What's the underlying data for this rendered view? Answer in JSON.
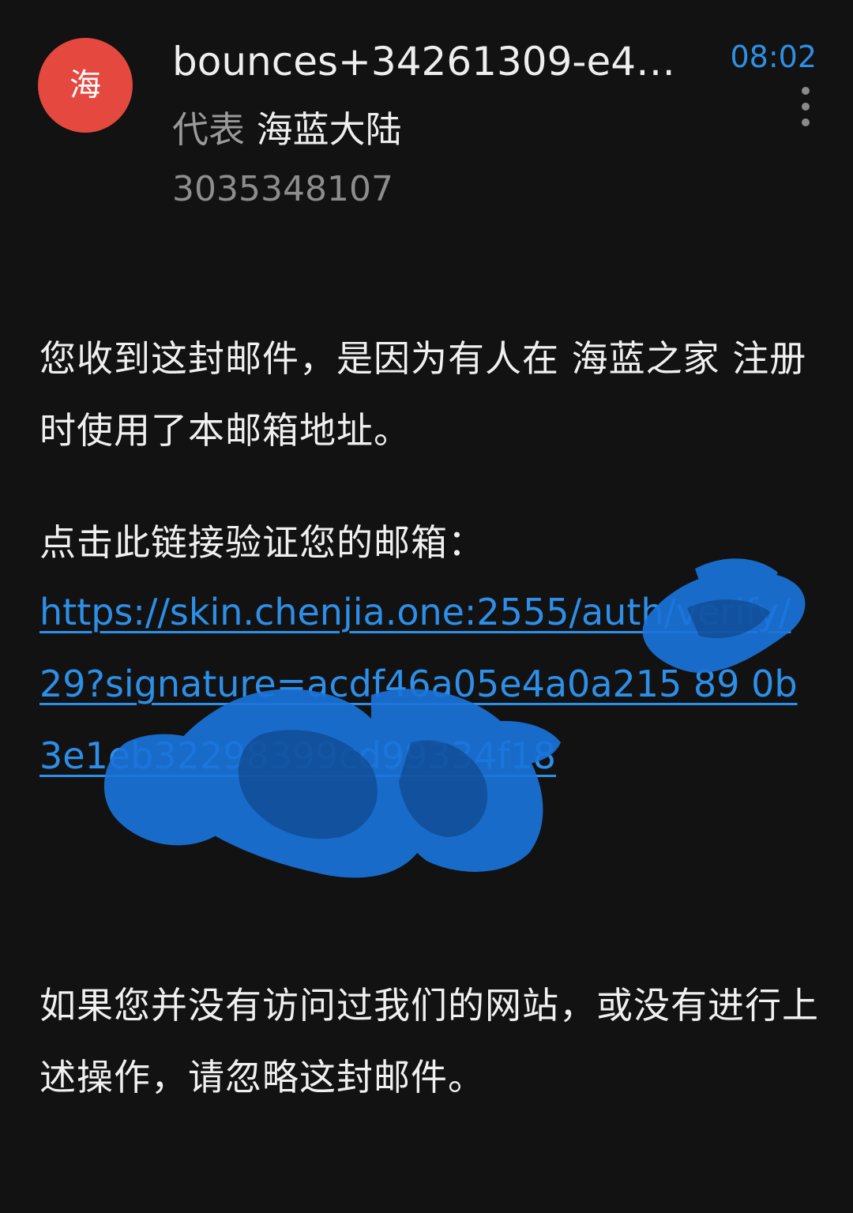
{
  "header": {
    "avatar_letter": "海",
    "avatar_color": "#e5483f",
    "sender": "bounces+34261309-e4…",
    "time": "08:02",
    "on_behalf_prefix": "代表",
    "on_behalf_name": "海蓝大陆",
    "number": "3035348107",
    "more_icon": "vertical-dots-icon"
  },
  "body": {
    "paragraph1": "您收到这封邮件，是因为有人在 海蓝之家 注册时使用了本邮箱地址。",
    "paragraph2": "点击此链接验证您的邮箱：",
    "link_text": "https://skin.chenjia.one:2555/auth/verify/29?signature=acdf46a05e4a0a215 89 0b 3e1eb32298399cd99334f18",
    "paragraph3": "如果您并没有访问过我们的网站，或没有进行上述操作，请忽略这封邮件。"
  },
  "colors": {
    "background": "#121212",
    "link": "#2d8fe8",
    "time": "#2f8fe6",
    "redaction": "#1a73d9"
  }
}
